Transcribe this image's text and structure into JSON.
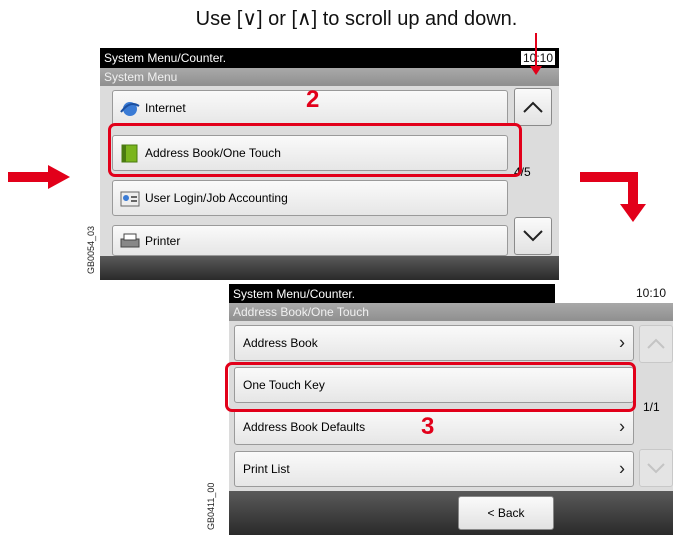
{
  "caption": "Use [∨] or [∧] to scroll up and down.",
  "screen1": {
    "title": "System Menu/Counter.",
    "time": "10:10",
    "subtitle": "System Menu",
    "items": [
      {
        "label": "Internet",
        "icon": "internet-icon"
      },
      {
        "label": "Address Book/One Touch",
        "icon": "address-book-icon"
      },
      {
        "label": "User Login/Job Accounting",
        "icon": "user-login-icon"
      },
      {
        "label": "Printer",
        "icon": "printer-icon"
      }
    ],
    "page_counter": "4/5",
    "side_label": "GB0054_03"
  },
  "screen2": {
    "title": "System Menu/Counter.",
    "time": "10:10",
    "subtitle": "Address Book/One Touch",
    "items": [
      {
        "label": "Address Book"
      },
      {
        "label": "One Touch Key"
      },
      {
        "label": "Address Book Defaults"
      },
      {
        "label": "Print List"
      }
    ],
    "page_counter": "1/1",
    "back_label": "< Back",
    "side_label": "GB0411_00"
  },
  "steps": [
    "2",
    "3"
  ],
  "colors": {
    "highlight": "#e2001a",
    "arrow": "#e2001a"
  }
}
